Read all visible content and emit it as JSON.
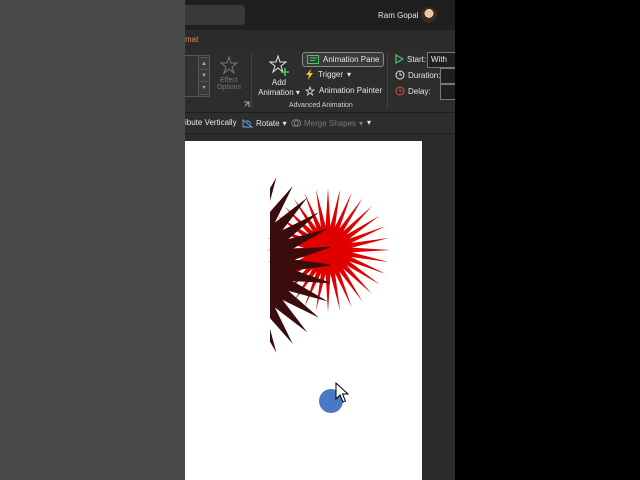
{
  "titlebar": {
    "user_name": "Ram Gopal"
  },
  "ribbon": {
    "active_tab_fragment": "mat",
    "effect_options": {
      "line1": "Effect",
      "line2": "Options"
    },
    "add_animation": {
      "line1": "Add",
      "line2": "Animation"
    },
    "advanced_animation": {
      "animation_pane": "Animation Pane",
      "trigger": "Trigger",
      "animation_painter": "Animation Painter",
      "group_label": "Advanced Animation"
    },
    "timing": {
      "start_label": "Start:",
      "start_value": "With Pre",
      "duration_label": "Duration:",
      "delay_label": "Delay:"
    }
  },
  "arrange_bar": {
    "distribute_vertically": "ibute Vertically",
    "rotate": "Rotate",
    "merge_shapes": "Merge Shapes"
  },
  "colors": {
    "starburst": "#e00000",
    "cursor_highlight": "#4a78c2",
    "accent_tab": "#f0824a"
  }
}
